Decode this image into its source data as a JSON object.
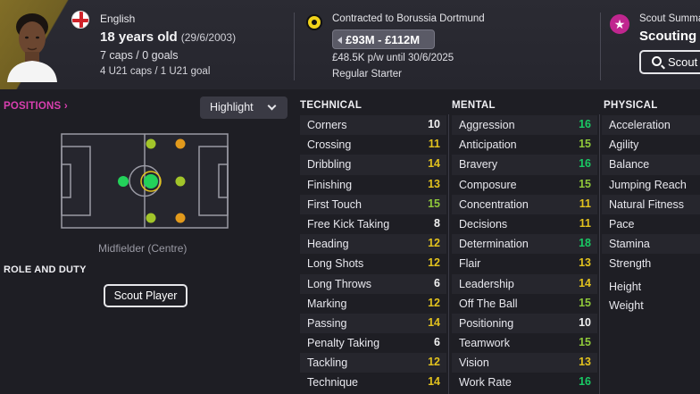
{
  "player": {
    "nationality": "English",
    "age": "18 years old",
    "dob": "(29/6/2003)",
    "caps": "7 caps / 0 goals",
    "u21": "4 U21 caps / 1 U21 goal"
  },
  "contract": {
    "club_line": "Contracted to Borussia Dortmund",
    "value_range": "£93M - £112M",
    "wage": "£48.5K p/w until 30/6/2025",
    "squad_status": "Regular Starter"
  },
  "scout": {
    "summary_label": "Scout Summa",
    "title": "Scouting I",
    "button_label": "Scout"
  },
  "positions": {
    "link_label": "POSITIONS ›",
    "highlight_label": "Highlight",
    "position_name": "Midfielder (Centre)",
    "role_duty_label": "ROLE AND DUTY",
    "scout_player_label": "Scout Player"
  },
  "colors": {
    "pink_accent": "#d93fb0",
    "attr_high": "#19c964",
    "attr_good": "#8fc83a",
    "attr_mid": "#e2c21e",
    "attr_low": "#f2f2f2",
    "natural_pos": "#23d15a",
    "accomplished_pos": "#a2c52a",
    "competent_pos": "#e29a1c"
  },
  "technical": {
    "heading": "TECHNICAL",
    "attrs": [
      {
        "name": "Corners",
        "value": "10",
        "color": "#f2f2f2"
      },
      {
        "name": "Crossing",
        "value": "11",
        "color": "#e2c21e"
      },
      {
        "name": "Dribbling",
        "value": "14",
        "color": "#e2c21e"
      },
      {
        "name": "Finishing",
        "value": "13",
        "color": "#e2c21e"
      },
      {
        "name": "First Touch",
        "value": "15",
        "color": "#8fc83a"
      },
      {
        "name": "Free Kick Taking",
        "value": "8",
        "color": "#f2f2f2"
      },
      {
        "name": "Heading",
        "value": "12",
        "color": "#e2c21e"
      },
      {
        "name": "Long Shots",
        "value": "12",
        "color": "#e2c21e"
      },
      {
        "name": "Long Throws",
        "value": "6",
        "color": "#f2f2f2"
      },
      {
        "name": "Marking",
        "value": "12",
        "color": "#e2c21e"
      },
      {
        "name": "Passing",
        "value": "14",
        "color": "#e2c21e"
      },
      {
        "name": "Penalty Taking",
        "value": "6",
        "color": "#f2f2f2"
      },
      {
        "name": "Tackling",
        "value": "12",
        "color": "#e2c21e"
      },
      {
        "name": "Technique",
        "value": "14",
        "color": "#e2c21e"
      }
    ]
  },
  "mental": {
    "heading": "MENTAL",
    "attrs": [
      {
        "name": "Aggression",
        "value": "16",
        "color": "#19c964"
      },
      {
        "name": "Anticipation",
        "value": "15",
        "color": "#8fc83a"
      },
      {
        "name": "Bravery",
        "value": "16",
        "color": "#19c964"
      },
      {
        "name": "Composure",
        "value": "15",
        "color": "#8fc83a"
      },
      {
        "name": "Concentration",
        "value": "11",
        "color": "#e2c21e"
      },
      {
        "name": "Decisions",
        "value": "11",
        "color": "#e2c21e"
      },
      {
        "name": "Determination",
        "value": "18",
        "color": "#19c964"
      },
      {
        "name": "Flair",
        "value": "13",
        "color": "#e2c21e"
      },
      {
        "name": "Leadership",
        "value": "14",
        "color": "#e2c21e"
      },
      {
        "name": "Off The Ball",
        "value": "15",
        "color": "#8fc83a"
      },
      {
        "name": "Positioning",
        "value": "10",
        "color": "#f2f2f2"
      },
      {
        "name": "Teamwork",
        "value": "15",
        "color": "#8fc83a"
      },
      {
        "name": "Vision",
        "value": "13",
        "color": "#e2c21e"
      },
      {
        "name": "Work Rate",
        "value": "16",
        "color": "#19c964"
      }
    ]
  },
  "physical": {
    "heading": "PHYSICAL",
    "attrs": [
      {
        "name": "Acceleration"
      },
      {
        "name": "Agility"
      },
      {
        "name": "Balance"
      },
      {
        "name": "Jumping Reach"
      },
      {
        "name": "Natural Fitness"
      },
      {
        "name": "Pace"
      },
      {
        "name": "Stamina"
      },
      {
        "name": "Strength"
      }
    ],
    "height_label": "Height",
    "weight_label": "Weight"
  }
}
